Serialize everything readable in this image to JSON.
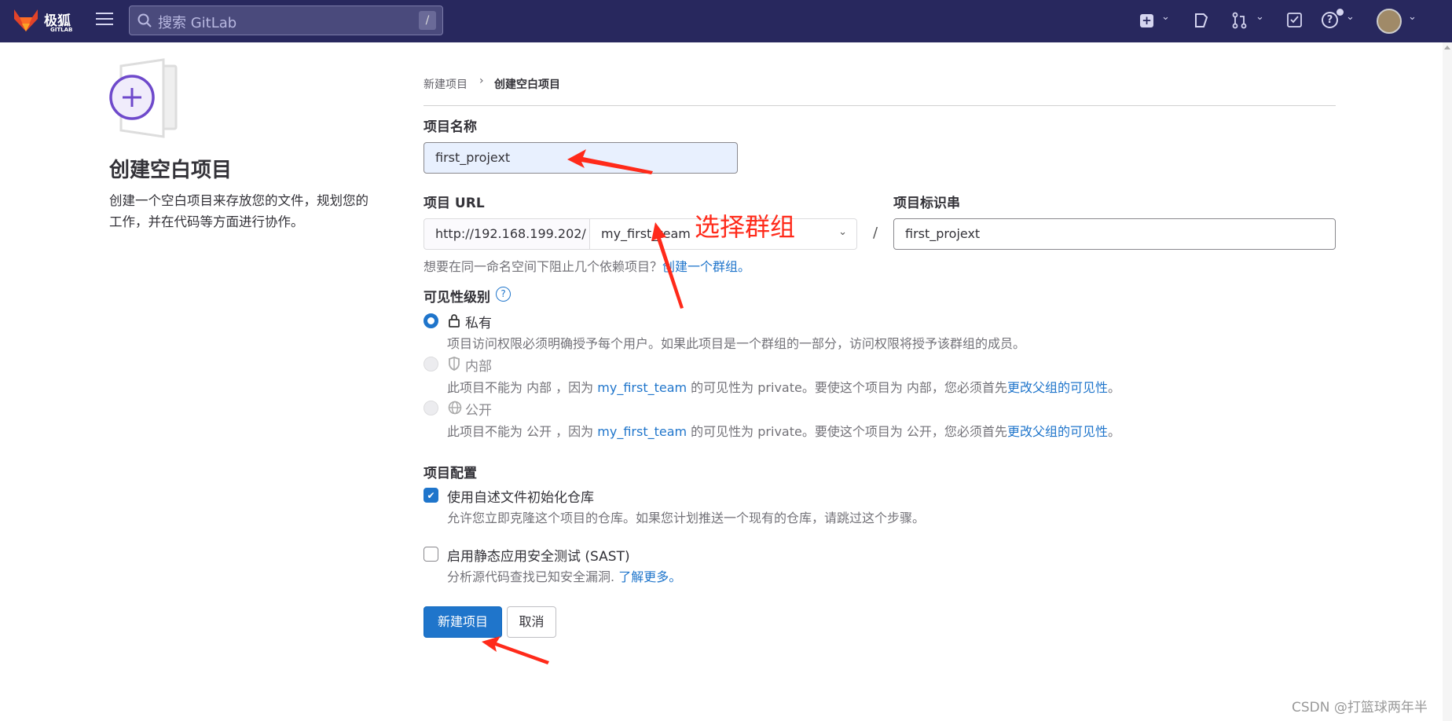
{
  "header": {
    "logo_text": "极狐",
    "logo_sub": "GITLAB",
    "search_placeholder": "搜索 GitLab",
    "search_shortcut": "/",
    "icons": [
      "plus-square-icon",
      "issues-icon",
      "merge-request-icon",
      "todo-icon",
      "help-icon",
      "avatar"
    ]
  },
  "sidebar": {
    "title": "创建空白项目",
    "description_line1": "创建一个空白项目来存放您的文件，规划您的",
    "description_line2": "工作，并在代码等方面进行协作。"
  },
  "breadcrumb": {
    "parent": "新建项目",
    "sep": "›",
    "current": "创建空白项目"
  },
  "form": {
    "name_label": "项目名称",
    "name_value": "first_projext",
    "url_label": "项目 URL",
    "url_prefix": "http://192.168.199.202/",
    "namespace_value": "my_first_team",
    "url_slash": "/",
    "slug_label": "项目标识串",
    "slug_value": "first_projext",
    "group_help": "想要在同一命名空间下阻止几个依赖项目？",
    "group_help_link": "创建一个群组。",
    "visibility_label": "可见性级别",
    "visibility_help_icon": "?",
    "visibility": [
      {
        "label": "私有",
        "icon": "lock-icon",
        "selected": true,
        "disabled": false,
        "desc": "项目访问权限必须明确授予每个用户。如果此项目是一个群组的一部分，访问权限将授予该群组的成员。"
      },
      {
        "label": "内部",
        "icon": "shield-icon",
        "selected": false,
        "disabled": true,
        "desc_pre": "此项目不能为 内部 ，因为 ",
        "desc_link1": "my_first_team",
        "desc_mid": " 的可见性为 private。要使这个项目为 内部，您必须首先",
        "desc_link2": "更改父组的可见性",
        "desc_end": "。"
      },
      {
        "label": "公开",
        "icon": "globe-icon",
        "selected": false,
        "disabled": true,
        "desc_pre": "此项目不能为 公开 ，因为 ",
        "desc_link1": "my_first_team",
        "desc_mid": " 的可见性为 private。要使这个项目为 公开，您必须首先",
        "desc_link2": "更改父组的可见性",
        "desc_end": "。"
      }
    ],
    "config_label": "项目配置",
    "readme": {
      "label": "使用自述文件初始化仓库",
      "checked": true,
      "desc": "允许您立即克隆这个项目的仓库。如果您计划推送一个现有的仓库，请跳过这个步骤。"
    },
    "sast": {
      "label": "启用静态应用安全测试 (SAST)",
      "checked": false,
      "desc": "分析源代码查找已知安全漏洞. ",
      "link": "了解更多。"
    },
    "submit": "新建项目",
    "cancel": "取消"
  },
  "annotation": {
    "text": "选择群组",
    "color": "#ff2a1a"
  },
  "watermark": "CSDN @打篮球两年半",
  "colors": {
    "topbar": "#28285e",
    "primary": "#1f75cb",
    "autofill": "#e8f0fe"
  }
}
